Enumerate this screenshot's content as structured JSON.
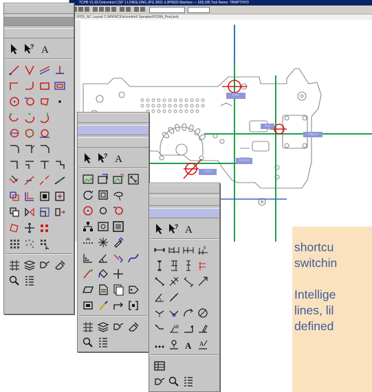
{
  "cad_window": {
    "title": "TCPB V1.93 Dolcontriol CSP 1:LONGLONG.JPG 3001 4,3P9920 Machine — 528,185 Tool Name: TRWPTHYD",
    "path": "C:\\PD5_NC Layout   C:\\MN\\NC\\Dolcontriol\\ Samples\\PCBM_Prod.pcb",
    "labels": [
      {
        "id": "lbl-1",
        "text": "Hole"
      },
      {
        "id": "lbl-2",
        "text": "Text"
      },
      {
        "id": "lbl-3",
        "text": "Object"
      },
      {
        "id": "lbl-4",
        "text": "Section"
      },
      {
        "id": "lbl-5",
        "text": "Point"
      }
    ]
  },
  "palettes": {
    "palette_1": {
      "rows": [
        [
          "arrow-icon",
          "query-arrow-icon",
          "text-tool-icon"
        ],
        [
          "line-icon",
          "angle-line-icon",
          "parallel-line-icon",
          "perpendicular-line-icon"
        ],
        [
          "polyline-icon",
          "arc-line-icon",
          "rectangle-icon",
          "rectangle-offset-icon"
        ],
        [
          "circle-icon",
          "circle-tangent-icon",
          "ellipse-icon",
          "point-icon"
        ],
        [
          "arc-icon",
          "arc-3pt-icon",
          "arc-tangent-icon"
        ],
        [
          "circle-2pt-icon",
          "circle-3pt-icon",
          "circle-tangent2-icon"
        ],
        [
          "fillet-icon",
          "fillet-offset-icon",
          "chamfer-icon"
        ],
        [
          "corner-icon",
          "corner-right-icon",
          "trim-corner-icon",
          "corner-step-icon"
        ],
        [
          "trim-icon",
          "extend-icon",
          "break-icon",
          "join-icon"
        ],
        [
          "offset-icon",
          "offset-corner-icon",
          "block-icon",
          "block-insert-icon"
        ],
        [
          "copy-icon",
          "mirror-icon",
          "scale-icon",
          "stretch-icon"
        ],
        [
          "rotate-icon",
          "move-icon",
          "array-icon"
        ],
        [
          "pattern-icon",
          "grid-dots-icon",
          "pattern-select-icon"
        ],
        [
          "hatch-icon",
          "layers-icon",
          "properties-icon",
          "eraser-icon"
        ],
        [
          "zoom-icon",
          "list-icon"
        ]
      ]
    },
    "palette_2": {
      "rows": [
        [
          "arrow-icon",
          "query-arrow-icon",
          "text-tool-icon"
        ],
        [
          "image-icon",
          "image-open-icon",
          "image-import-icon",
          "image-resize-icon"
        ],
        [
          "rotate-view-icon",
          "frame-icon",
          "lasso-icon"
        ],
        [
          "circle-icon",
          "circle-small-icon",
          "circle-tangent-icon"
        ],
        [
          "hierarchy-icon",
          "table-tool-icon",
          "boundary-icon"
        ],
        [
          "dotted-line-icon",
          "starburst-icon",
          "pipette-icon"
        ],
        [
          "measure-corner-icon",
          "angle-measure-icon",
          "probe-icon",
          "spline-icon"
        ],
        [
          "pen-icon",
          "paint-bucket-icon",
          "crosshair-icon"
        ],
        [
          "parallelogram-icon",
          "document-icon",
          "layers-stack-icon",
          "tag-icon"
        ],
        [
          "frame-small-icon",
          "brush-icon",
          "route-icon",
          "bracket-icon"
        ],
        [
          "hatch-icon",
          "layers-icon",
          "properties-icon",
          "eraser-icon"
        ],
        [
          "zoom-icon",
          "list-icon"
        ]
      ]
    },
    "palette_3": {
      "rows": [
        [
          "arrow-icon",
          "query-arrow-icon",
          "text-tool-icon"
        ],
        [
          "dim-horizontal-icon",
          "dim-baseline-icon",
          "dim-chain-icon",
          "dim-origin-icon"
        ],
        [
          "dim-vertical-icon",
          "dim-vertical-baseline-icon",
          "dim-vertical-chain-icon",
          "dim-vertical-origin-icon"
        ],
        [
          "dim-aligned-icon",
          "dim-aligned-baseline-icon",
          "dim-aligned-chain-icon",
          "dim-aligned-origin-icon"
        ],
        [
          "dim-angle-icon",
          "dim-angle-chain-icon"
        ],
        [
          "dim-radius-icon",
          "dim-diameter-icon",
          "dim-arc-icon",
          "dim-circle-icon"
        ],
        [
          "leader-icon",
          "leader-text-icon",
          "leader-arrow-icon",
          "leader-edit-icon"
        ],
        [
          "dots-icon",
          "datum-icon",
          "text-icon",
          "label-edit-icon"
        ],
        [
          "table-icon"
        ],
        [
          "properties-icon",
          "zoom-icon",
          "list-icon"
        ]
      ]
    }
  },
  "text_panel": {
    "lines": [
      "shortcu",
      "switchin",
      "",
      "Intellige",
      "lines, lil",
      "defined"
    ]
  }
}
